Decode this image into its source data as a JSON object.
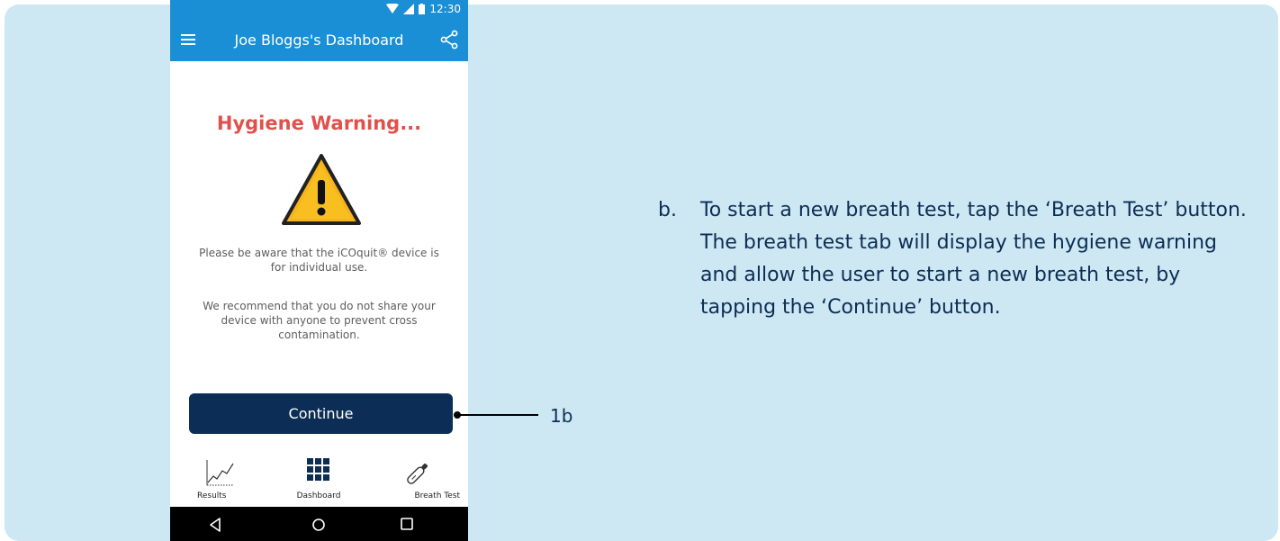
{
  "status_bar": {
    "time": "12:30"
  },
  "app_bar": {
    "title": "Joe Bloggs's Dashboard"
  },
  "warning": {
    "title": "Hygiene Warning...",
    "message_1": "Please be aware that the iCOquit® device is for individual use.",
    "message_2": "We recommend that you do not share your device with anyone to prevent cross contamination."
  },
  "continue_button": {
    "label": "Continue"
  },
  "tabs": [
    {
      "label": "Results",
      "icon": "chart-icon"
    },
    {
      "label": "Dashboard",
      "icon": "grid-icon"
    },
    {
      "label": "Breath Test",
      "icon": "breath-device-icon"
    }
  ],
  "callout": {
    "label": "1b"
  },
  "instruction": {
    "marker": "b.",
    "text": "To start a new breath test, tap the ‘Breath Test’ button. The breath test tab will display the hygiene warning and allow the user to start a new breath test, by tapping the ‘Continue’ button."
  },
  "colors": {
    "panel_background": "#cde8f3",
    "app_bar": "#1b8fd6",
    "warning_title": "#e0514c",
    "button": "#0c2d55",
    "instruction_text": "#0c2d55"
  }
}
